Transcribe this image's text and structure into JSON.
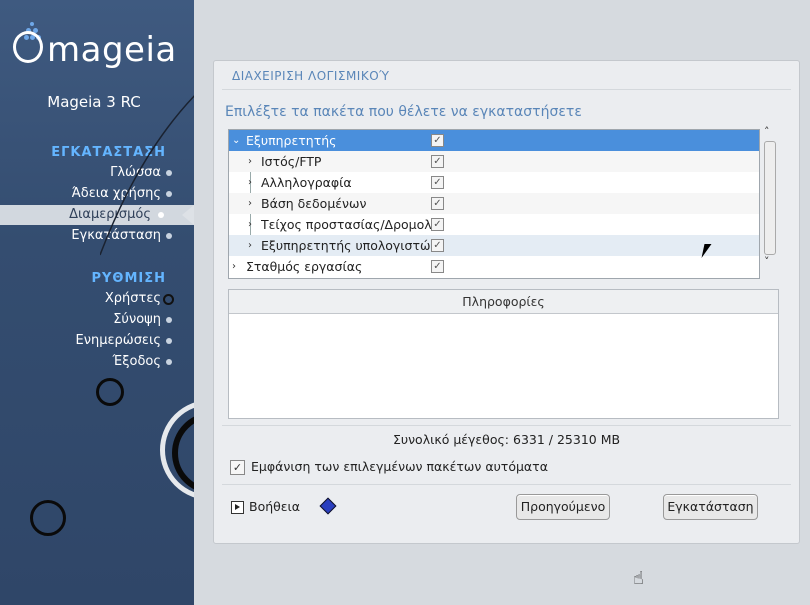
{
  "sidebar": {
    "brand": "mageia",
    "version": "Mageia 3 RC",
    "section_install": "ΕΓΚΑΤΑΣΤΑΣΗ",
    "install_steps": [
      "Γλώσσα",
      "Άδεια χρήσης",
      "Διαμερισμός",
      "Εγκατάσταση"
    ],
    "section_config": "ΡΥΘΜΙΣΗ",
    "config_steps": [
      "Χρήστες",
      "Σύνοψη",
      "Ενημερώσεις",
      "Έξοδος"
    ]
  },
  "panel": {
    "title": "ΔΙΑΧΕΙΡΙΣΗ ΛΟΓΙΣΜΙΚΟΎ",
    "prompt": "Επιλέξτε τα πακέτα που θέλετε να εγκαταστήσετε",
    "tree": [
      {
        "label": "Εξυπηρετητής",
        "checked": true
      },
      {
        "label": "Ιστός/FTP",
        "checked": true
      },
      {
        "label": "Αλληλογραφία",
        "checked": true
      },
      {
        "label": "Βάση δεδομένων",
        "checked": true
      },
      {
        "label": "Τείχος προστασίας/Δρομολ",
        "checked": true
      },
      {
        "label": "Εξυπηρετητής υπολογιστώ",
        "checked": true
      },
      {
        "label": "Σταθμός εργασίας",
        "checked": true
      }
    ],
    "info_header": "Πληροφορίες",
    "total_size": "Συνολικό μέγεθος: 6331 / 25310 MB",
    "auto_show_label": "Εμφάνιση των επιλεγμένων πακέτων αυτόματα",
    "help_label": "Βοήθεια",
    "prev_button": "Προηγούμενο",
    "install_button": "Εγκατάσταση",
    "checkmark": "✓"
  },
  "colors": {
    "accent": "#5a86b8",
    "selection": "#4a8fdc",
    "sidebar": "#3a547a",
    "section": "#64b5ff"
  }
}
